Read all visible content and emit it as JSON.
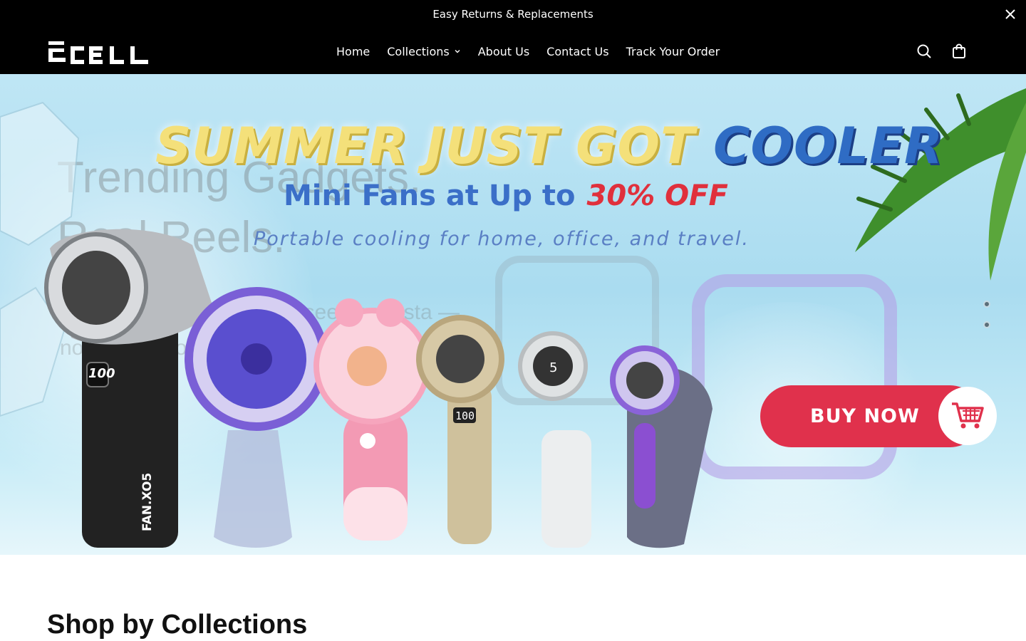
{
  "announcement": {
    "text": "Easy Returns & Replacements"
  },
  "header": {
    "brand": "ECELL",
    "nav": [
      "Home",
      "Collections",
      "About Us",
      "Contact Us",
      "Track Your Order"
    ],
    "icons": [
      "search-icon",
      "shopping-bag-icon"
    ]
  },
  "hero": {
    "headline_part1": "SUMMER JUST GOT",
    "headline_part2": "COOLER",
    "subheadline": "Mini Fans at Up to",
    "discount": "30% OFF",
    "tagline": "Portable cooling for home, office, and travel.",
    "buy_label": "BUY NOW",
    "overlay_title_line1": "Trending Gadgets.",
    "overlay_title_line2": "Real Reels.",
    "overlay_subtitle": "Discover products you've seen on Insta — now in your own.",
    "slides": 2,
    "active_slide": 1
  },
  "fans": {
    "black_label": "FAN.XO5",
    "black_display": "100",
    "gold_display": "100",
    "white_display": "5"
  },
  "section": {
    "title": "Shop by Collections"
  },
  "colors": {
    "bar": "#000000",
    "buy": "#e0314c",
    "headline_blue": "#2f6cc4",
    "headline_yellow": "#f4e07a"
  }
}
